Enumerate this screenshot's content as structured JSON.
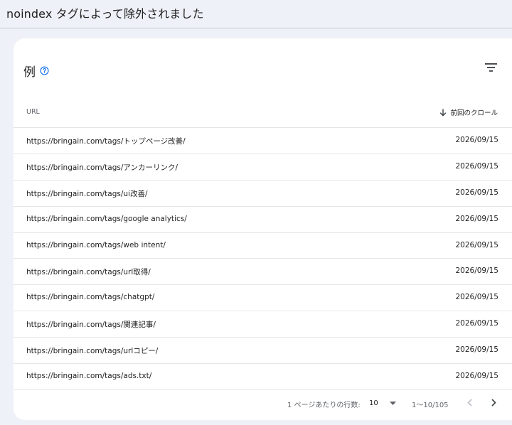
{
  "page": {
    "title": "noindex タグによって除外されました"
  },
  "card": {
    "title": "例"
  },
  "table": {
    "columns": {
      "url": "URL",
      "date": "前回のクロール"
    },
    "rows": [
      {
        "url": "https://bringain.com/tags/トップページ改善/",
        "date": "2026/09/15"
      },
      {
        "url": "https://bringain.com/tags/アンカーリンク/",
        "date": "2026/09/15"
      },
      {
        "url": "https://bringain.com/tags/ui改善/",
        "date": "2026/09/15"
      },
      {
        "url": "https://bringain.com/tags/google analytics/",
        "date": "2026/09/15"
      },
      {
        "url": "https://bringain.com/tags/web intent/",
        "date": "2026/09/15"
      },
      {
        "url": "https://bringain.com/tags/url取得/",
        "date": "2026/09/15"
      },
      {
        "url": "https://bringain.com/tags/chatgpt/",
        "date": "2026/09/15"
      },
      {
        "url": "https://bringain.com/tags/関連記事/",
        "date": "2026/09/15"
      },
      {
        "url": "https://bringain.com/tags/urlコピー/",
        "date": "2026/09/15"
      },
      {
        "url": "https://bringain.com/tags/ads.txt/",
        "date": "2026/09/15"
      }
    ]
  },
  "pagination": {
    "rows_per_page_label": "1 ページあたりの行数:",
    "rows_per_page_value": "10",
    "range": "1〜10/105"
  },
  "icons": {
    "help": "help-circle-icon",
    "filter": "filter-list-icon",
    "sort": "arrow-down-icon",
    "caret": "caret-down-icon",
    "prev": "chevron-left-icon",
    "next": "chevron-right-icon"
  },
  "colors": {
    "accent": "#1a73e8",
    "background": "#eef1f7"
  }
}
